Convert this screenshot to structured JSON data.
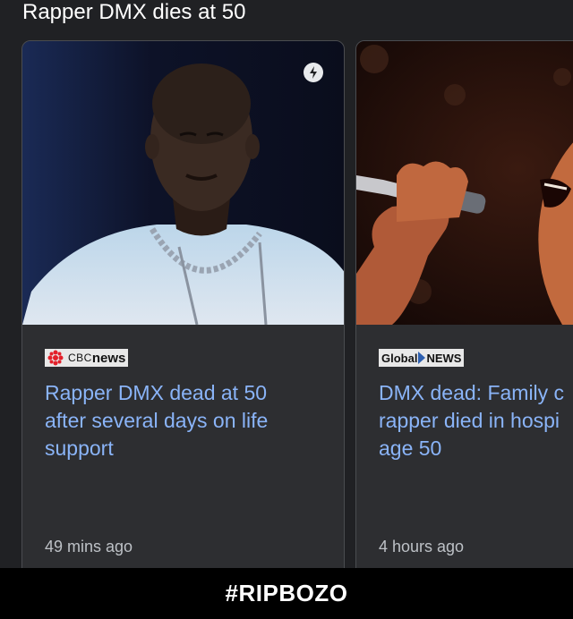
{
  "header": {
    "title": "Rapper DMX dies at 50"
  },
  "cards": [
    {
      "source": {
        "prefix": "CBC",
        "name": "news"
      },
      "headline": "Rapper DMX dead at 50\nafter several days on life\nsupport",
      "time": "49 mins ago",
      "amp_icon": "lightning-bolt-icon"
    },
    {
      "source": {
        "prefix": "Global",
        "name": "NEWS"
      },
      "headline": "DMX dead: Family c\nrapper died in hospi\nage 50",
      "time": "4 hours ago"
    }
  ],
  "footer": {
    "caption": "#RIPBOZO"
  },
  "colors": {
    "background": "#202124",
    "card": "#2d2e31",
    "link": "#8ab4f8",
    "footer": "#000000"
  }
}
